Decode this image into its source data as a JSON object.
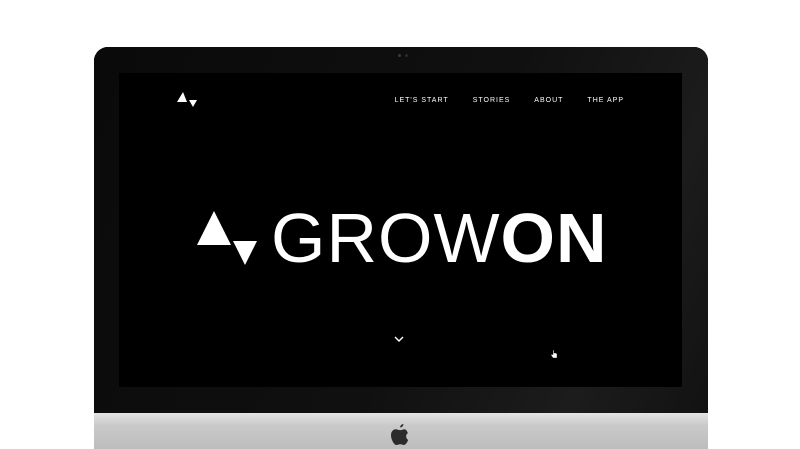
{
  "nav": {
    "items": [
      {
        "label": "LET'S START"
      },
      {
        "label": "STORIES"
      },
      {
        "label": "ABOUT"
      },
      {
        "label": "THE APP"
      }
    ]
  },
  "hero": {
    "word_part1": "GROW",
    "word_part2": "ON"
  },
  "icons": {
    "brand": "growon-logo-icon",
    "scroll": "chevron-down-icon",
    "device": "apple-logo-icon",
    "pointer": "hand-cursor-icon"
  },
  "colors": {
    "background": "#000000",
    "text": "#ffffff",
    "chin": "#c9c9c9"
  }
}
